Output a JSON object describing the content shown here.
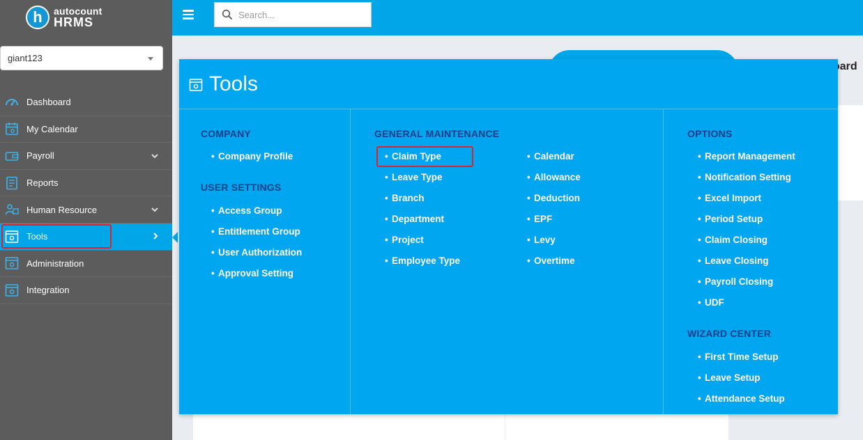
{
  "app": {
    "logo_letter": "h",
    "logo_top": "autocount",
    "logo_bottom": "HRMS",
    "company_select_value": "giant123"
  },
  "sidebar": {
    "items": [
      {
        "label": "Dashboard",
        "icon": "speedometer-icon"
      },
      {
        "label": "My Calendar",
        "icon": "calendar-icon"
      },
      {
        "label": "Payroll",
        "icon": "wallet-icon",
        "expandable": true
      },
      {
        "label": "Reports",
        "icon": "report-icon"
      },
      {
        "label": "Human Resource",
        "icon": "people-icon",
        "expandable": true
      },
      {
        "label": "Tools",
        "icon": "tools-window-icon",
        "active": true
      },
      {
        "label": "Administration",
        "icon": "admin-window-icon"
      },
      {
        "label": "Integration",
        "icon": "integration-window-icon"
      }
    ]
  },
  "topbar": {
    "search_placeholder": "Search..."
  },
  "background": {
    "heading_fragment": "oard"
  },
  "tools_menu": {
    "title": "Tools",
    "company": {
      "title": "COMPANY",
      "items": [
        "Company Profile"
      ]
    },
    "user_settings": {
      "title": "USER SETTINGS",
      "items": [
        "Access Group",
        "Entitlement Group",
        "User Authorization",
        "Approval Setting"
      ]
    },
    "general_maintenance": {
      "title": "GENERAL MAINTENANCE",
      "col1": [
        "Claim Type",
        "Leave Type",
        "Branch",
        "Department",
        "Project",
        "Employee Type"
      ],
      "col2": [
        "Calendar",
        "Allowance",
        "Deduction",
        "EPF",
        "Levy",
        "Overtime"
      ]
    },
    "options": {
      "title": "OPTIONS",
      "items": [
        "Report Management",
        "Notification Setting",
        "Excel Import",
        "Period Setup",
        "Claim Closing",
        "Leave Closing",
        "Payroll Closing",
        "UDF"
      ]
    },
    "wizard_center": {
      "title": "WIZARD CENTER",
      "items": [
        "First Time Setup",
        "Leave Setup",
        "Attendance Setup"
      ]
    }
  },
  "colors": {
    "accent": "#00a6e8",
    "sidebar_bg": "#5c5c5c",
    "section_title": "#1a3e8a",
    "highlight_box": "#d8262f"
  }
}
